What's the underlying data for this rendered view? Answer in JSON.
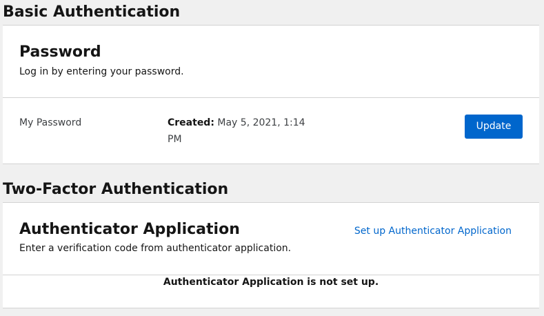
{
  "basic_auth": {
    "title": "Basic Authentication",
    "password_card": {
      "title": "Password",
      "description": "Log in by entering your password.",
      "credential_label": "My Password",
      "created_label": "Created:",
      "created_value": " May 5, 2021, 1:14 PM",
      "update_label": "Update"
    }
  },
  "two_factor": {
    "title": "Two-Factor Authentication",
    "authenticator_card": {
      "title": "Authenticator Application",
      "description": "Enter a verification code from authenticator application.",
      "setup_link": "Set up Authenticator Application",
      "status_message": "Authenticator Application is not set up."
    }
  },
  "colors": {
    "primary": "#0066cc",
    "background": "#f0f0f0",
    "card": "#ffffff",
    "border": "#d2d2d2"
  }
}
